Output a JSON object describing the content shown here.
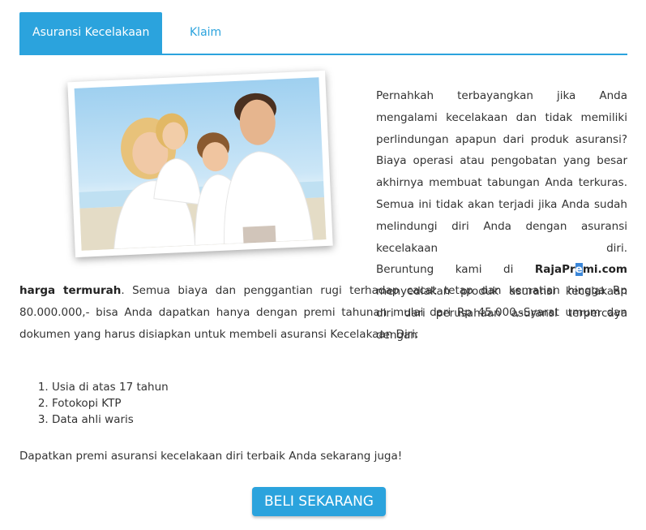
{
  "tabs": [
    {
      "label": "Asuransi Kecelakaan Diri",
      "active": true
    },
    {
      "label": "Klaim",
      "active": false
    }
  ],
  "colors": {
    "accent": "#2ba3dd",
    "text": "#333333"
  },
  "intro": {
    "p1": "Pernahkah terbayangkan jika Anda mengalami kecelakaan dan tidak memiliki perlindungan apapun dari produk asuransi? Biaya operasi atau pengobatan yang besar akhirnya membuat tabungan Anda terkuras. Semua ini tidak akan terjadi jika Anda sudah melindungi diri Anda dengan asuransi kecelakaan diri.",
    "p2_start": "Beruntung kami di",
    "brand_a": "RajaPr",
    "brand_hl": "e",
    "brand_b": "mi.com",
    "p2_mid": "menyediakan produk asuransi kecelakaan diri dari perusahaan asuransi terpercaya dengan",
    "bold_price": "harga termurah",
    "p2_end": ". Semua biaya dan penggantian rugi terhadap cacat tetap dan kematian hingga Rp 80.000.000,- bisa Anda dapatkan hanya dengan premi tahunan mulai dari Rp 45.000,-Syarat umum dan dokumen yang harus disiapkan untuk membeli asuransi Kecelakaan Diri:"
  },
  "requirements": [
    "Usia di atas 17 tahun",
    "Fotokopi KTP",
    "Data ahli waris"
  ],
  "cta_text": "Dapatkan premi asuransi kecelakaan diri terbaik Anda sekarang juga!",
  "button_label": "BELI SEKARANG"
}
